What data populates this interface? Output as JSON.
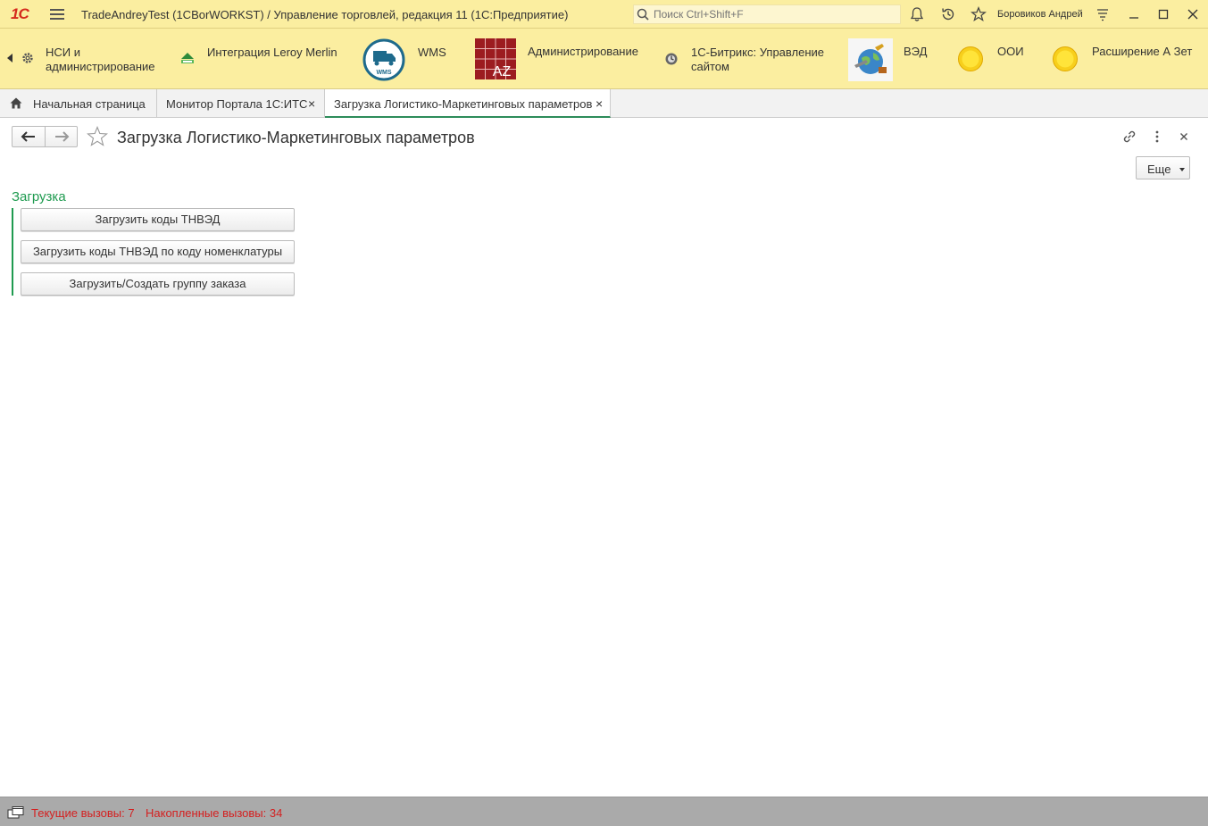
{
  "titlebar": {
    "logo": "1С",
    "app_title": "TradeAndreyTest (1CBorWORKST) / Управление торговлей, редакция 11  (1С:Предприятие)",
    "search_placeholder": "Поиск Ctrl+Shift+F",
    "user_name": "Боровиков Андрей"
  },
  "sections": [
    {
      "label_line1": "НСИ и",
      "label_line2": "администрирование",
      "icon": "gear-icon"
    },
    {
      "label_line1": "Интеграция Leroy Merlin",
      "label_line2": "",
      "icon": "leroy-merlin-icon"
    },
    {
      "label_line1": "WMS",
      "label_line2": "",
      "icon": "wms-truck-icon",
      "icon_text": "WMS"
    },
    {
      "label_line1": "Администрирование",
      "label_line2": "",
      "icon": "az-grid-icon",
      "icon_text": "AZ"
    },
    {
      "label_line1": "1С-Битрикс: Управление",
      "label_line2": "сайтом",
      "icon": "bitrix-icon"
    },
    {
      "label_line1": "ВЭД",
      "label_line2": "",
      "icon": "globe-icon"
    },
    {
      "label_line1": "ООИ",
      "label_line2": "",
      "icon": "yellow-circle-icon"
    },
    {
      "label_line1": "Расширение А Зет",
      "label_line2": "",
      "icon": "yellow-circle-icon"
    }
  ],
  "tabs": [
    {
      "label": "Начальная страница",
      "closable": false,
      "active": false
    },
    {
      "label": "Монитор Портала 1С:ИТС",
      "closable": true,
      "active": false
    },
    {
      "label": "Загрузка Логистико-Маркетинговых параметров",
      "closable": true,
      "active": true
    }
  ],
  "tab_close_glyph": "×",
  "form": {
    "title": "Загрузка Логистико-Маркетинговых параметров",
    "more_label": "Еще",
    "group_title": "Загрузка",
    "actions": [
      {
        "label": "Загрузить коды ТНВЭД"
      },
      {
        "label": "Загрузить коды ТНВЭД по коду номенклатуры"
      },
      {
        "label": "Загрузить/Создать группу заказа"
      }
    ]
  },
  "statusbar": {
    "current_calls": "Текущие вызовы: 7",
    "accumulated_calls": "Накопленные вызовы: 34"
  },
  "colors": {
    "titlebar_bg": "#fbeea0",
    "accent_green": "#1f9b50",
    "status_red": "#d42020",
    "logo_red": "#d52b1e",
    "az_red": "#9c1c20"
  }
}
